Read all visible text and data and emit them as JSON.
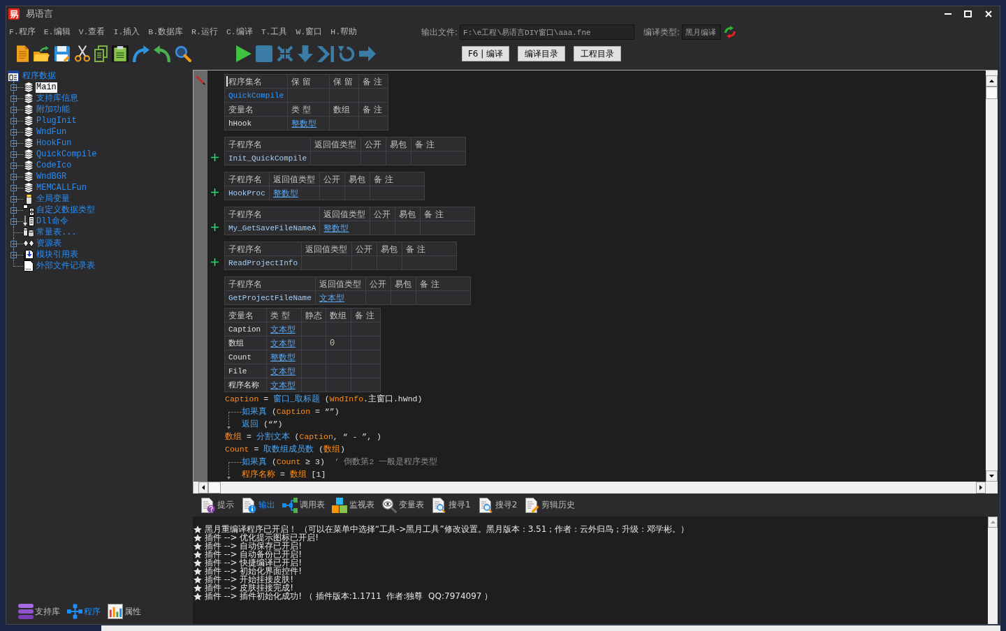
{
  "window": {
    "title": "易语言"
  },
  "menu": [
    "F.程序",
    "E.编辑",
    "V.查看",
    "I.插入",
    "B.数据库",
    "R.运行",
    "C.编译",
    "T.工具",
    "W.窗口",
    "H.帮助"
  ],
  "output_file": {
    "label": "输出文件:",
    "value": "F:\\e工程\\易语言DIY窗口\\aaa.fne"
  },
  "compile_type": {
    "label": "编译类型:",
    "value": "黑月编译"
  },
  "compile_buttons": [
    "F6 | 编译",
    "编译目录",
    "工程目录"
  ],
  "tree": {
    "label": "程序数据",
    "children": [
      {
        "label": "Main",
        "kind": "module",
        "expandable": true,
        "selected": true
      },
      {
        "label": "支持库信息",
        "kind": "module",
        "expandable": true,
        "selected": false
      },
      {
        "label": "附加功能",
        "kind": "module",
        "expandable": true,
        "selected": false
      },
      {
        "label": "PlugInit",
        "kind": "module",
        "expandable": true,
        "selected": false
      },
      {
        "label": "WndFun",
        "kind": "module",
        "expandable": true,
        "selected": false
      },
      {
        "label": "HookFun",
        "kind": "module",
        "expandable": true,
        "selected": false
      },
      {
        "label": "QuickCompile",
        "kind": "module",
        "expandable": true,
        "selected": false
      },
      {
        "label": "CodeIco",
        "kind": "module",
        "expandable": true,
        "selected": false
      },
      {
        "label": "WndBGR",
        "kind": "module",
        "expandable": true,
        "selected": false
      },
      {
        "label": "MEMCALLFun",
        "kind": "module",
        "expandable": true,
        "selected": false
      },
      {
        "label": "全局变量",
        "kind": "global",
        "expandable": true,
        "selected": false
      },
      {
        "label": "自定义数据类型",
        "kind": "datatype",
        "expandable": true,
        "selected": false
      },
      {
        "label": "Dll命令",
        "kind": "dll",
        "expandable": true,
        "selected": false
      },
      {
        "label": "常量表...",
        "kind": "const",
        "expandable": false,
        "selected": false
      },
      {
        "label": "资源表",
        "kind": "resource",
        "expandable": true,
        "selected": false
      },
      {
        "label": "模块引用表",
        "kind": "moduleref",
        "expandable": true,
        "selected": false
      },
      {
        "label": "外部文件记录表",
        "kind": "file",
        "expandable": false,
        "selected": false
      }
    ]
  },
  "side_tabs": [
    {
      "label": "支持库",
      "kind": "library",
      "selected": false
    },
    {
      "label": "程序",
      "kind": "program",
      "selected": true
    },
    {
      "label": "属性",
      "kind": "properties",
      "selected": false
    }
  ],
  "editor": {
    "blocks": [
      {
        "kind": "assembly",
        "has_cursor": true,
        "header": [
          "程序集名",
          "保 留",
          "保 留",
          "备 注"
        ],
        "name": "QuickCompile",
        "var_header": [
          "变量名",
          "类 型",
          "数组",
          "备 注"
        ],
        "vars": [
          {
            "name": "hHook",
            "type": "整数型"
          }
        ]
      },
      {
        "kind": "sub",
        "collapsed": true,
        "header": [
          "子程序名",
          "返回值类型",
          "公开",
          "易包",
          "备 注"
        ],
        "name": "Init_QuickCompile"
      },
      {
        "kind": "sub",
        "collapsed": true,
        "header": [
          "子程序名",
          "返回值类型",
          "公开",
          "易包",
          "备 注"
        ],
        "name": "HookProc",
        "return_type": "整数型"
      },
      {
        "kind": "sub",
        "collapsed": true,
        "header": [
          "子程序名",
          "返回值类型",
          "公开",
          "易包",
          "备 注"
        ],
        "name": "My_GetSaveFileNameA",
        "return_type": "整数型"
      },
      {
        "kind": "sub",
        "collapsed": true,
        "header": [
          "子程序名",
          "返回值类型",
          "公开",
          "易包",
          "备 注"
        ],
        "name": "ReadProjectInfo"
      },
      {
        "kind": "sub",
        "collapsed": false,
        "header": [
          "子程序名",
          "返回值类型",
          "公开",
          "易包",
          "备 注"
        ],
        "name": "GetProjectFileName",
        "return_type": "文本型",
        "var_header": [
          "变量名",
          "类 型",
          "静态",
          "数组",
          "备 注"
        ],
        "vars": [
          {
            "name": "Caption",
            "type": "文本型"
          },
          {
            "name": "数组",
            "type": "文本型",
            "array": "0"
          },
          {
            "name": "Count",
            "type": "整数型"
          },
          {
            "name": "File",
            "type": "文本型"
          },
          {
            "name": "程序名称",
            "type": "文本型"
          }
        ],
        "code": [
          {
            "tokens": [
              {
                "kind": "var",
                "text": "Caption"
              },
              {
                "kind": "plain",
                "text": " = "
              },
              {
                "kind": "cmd",
                "text": "窗口_取标题"
              },
              {
                "kind": "plain",
                "text": " ("
              },
              {
                "kind": "var",
                "text": "WndInfo"
              },
              {
                "kind": "plain",
                "text": ".主窗口.hWnd)"
              }
            ]
          },
          {
            "tokens": [
              {
                "kind": "cmd",
                "text": "如果真"
              },
              {
                "kind": "plain",
                "text": " ("
              },
              {
                "kind": "var",
                "text": "Caption"
              },
              {
                "kind": "plain",
                "text": " = “”)"
              }
            ],
            "children": [
              {
                "tokens": [
                  {
                    "kind": "cmd",
                    "text": "返回"
                  },
                  {
                    "kind": "plain",
                    "text": " (“”)"
                  }
                ]
              }
            ]
          },
          {
            "tokens": [
              {
                "kind": "var",
                "text": "数组"
              },
              {
                "kind": "plain",
                "text": " = "
              },
              {
                "kind": "cmd",
                "text": "分割文本"
              },
              {
                "kind": "plain",
                "text": " ("
              },
              {
                "kind": "var",
                "text": "Caption"
              },
              {
                "kind": "plain",
                "text": ", “ - ”, )"
              }
            ]
          },
          {
            "tokens": [
              {
                "kind": "var",
                "text": "Count"
              },
              {
                "kind": "plain",
                "text": " = "
              },
              {
                "kind": "cmd",
                "text": "取数组成员数"
              },
              {
                "kind": "plain",
                "text": " ("
              },
              {
                "kind": "var",
                "text": "数组"
              },
              {
                "kind": "plain",
                "text": ")"
              }
            ]
          },
          {
            "tokens": [
              {
                "kind": "cmd",
                "text": "如果真"
              },
              {
                "kind": "plain",
                "text": " ("
              },
              {
                "kind": "var",
                "text": "Count"
              },
              {
                "kind": "plain",
                "text": " ≥ 3)"
              },
              {
                "kind": "comment",
                "text": "  ’ 倒数第2 一般是程序类型"
              }
            ],
            "children": [
              {
                "tokens": [
                  {
                    "kind": "var",
                    "text": "程序名称"
                  },
                  {
                    "kind": "plain",
                    "text": " = "
                  },
                  {
                    "kind": "var",
                    "text": "数组"
                  },
                  {
                    "kind": "plain",
                    "text": " [1]"
                  }
                ]
              }
            ]
          }
        ]
      }
    ]
  },
  "bottom_tabs": [
    {
      "label": "提示",
      "kind": "hint",
      "selected": false
    },
    {
      "label": "输出",
      "kind": "output",
      "selected": true
    },
    {
      "label": "调用表",
      "kind": "calls",
      "selected": false
    },
    {
      "label": "监视表",
      "kind": "watch",
      "selected": false
    },
    {
      "label": "变量表",
      "kind": "variables",
      "selected": false
    },
    {
      "label": "搜寻1",
      "kind": "search",
      "selected": false
    },
    {
      "label": "搜寻2",
      "kind": "search",
      "selected": false
    },
    {
      "label": "剪辑历史",
      "kind": "clips",
      "selected": false
    }
  ],
  "output_lines": [
    "黑月重编译程序已开启！ （可以在菜单中选择“工具->黑月工具”修改设置。黑月版本：3.51；作者：云外归鸟；升级：邓学彬。）",
    "插件 --> 优化提示图标已开启!",
    "插件 --> 自动保存已开启!",
    "插件 --> 自动备份已开启!",
    "插件 --> 快捷编译已开启!",
    "插件 --> 初始化界面控件!",
    "插件 --> 开始挂接皮肤!",
    "插件 --> 皮肤挂接完成!",
    "插件 --> 插件初始化成功! （ 插件版本:1.1711  作者:独尊  QQ:7974097 ）"
  ]
}
